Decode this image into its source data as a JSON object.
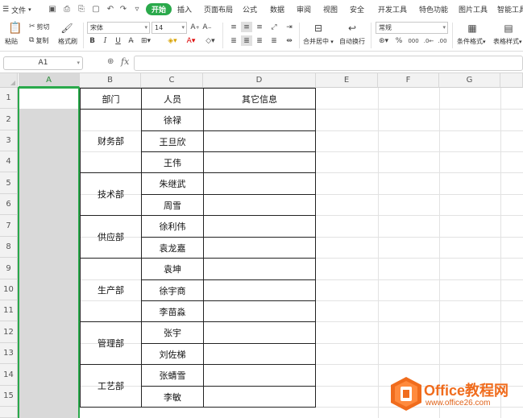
{
  "ribbon": {
    "file_menu": "文件",
    "tabs": [
      "开始",
      "插入",
      "页面布局",
      "公式",
      "数据",
      "审阅",
      "视图",
      "安全",
      "开发工具",
      "特色功能",
      "图片工具",
      "智能工具"
    ],
    "active_tab": "开始",
    "paste": "粘贴",
    "cut": "剪切",
    "copy": "复制",
    "format_painter": "格式刷",
    "font_name": "宋体",
    "font_size": "14",
    "merge_center": "合并居中",
    "wrap_text": "自动换行",
    "number_format": "常规",
    "conditional_format": "条件格式",
    "table_style": "表格样式",
    "accent_color": "#2aa94b"
  },
  "formula_bar": {
    "name_box": "A1",
    "fx_label": "fx",
    "formula_value": ""
  },
  "grid": {
    "columns": [
      "A",
      "B",
      "C",
      "D",
      "E",
      "F",
      "G"
    ],
    "rows": [
      "1",
      "2",
      "3",
      "4",
      "5",
      "6",
      "7",
      "8",
      "9",
      "10",
      "11",
      "12",
      "13",
      "14",
      "15"
    ],
    "selected_column": "A",
    "selection_color": "#2aa94b"
  },
  "table": {
    "headers": {
      "dept": "部门",
      "person": "人员",
      "other": "其它信息"
    },
    "departments": [
      "财务部",
      "技术部",
      "供应部",
      "生产部",
      "管理部",
      "工艺部"
    ],
    "people": [
      "徐禄",
      "王旦欣",
      "王伟",
      "朱继武",
      "周雪",
      "徐利伟",
      "袁龙嘉",
      "袁坤",
      "徐宇商",
      "李苗淼",
      "张宇",
      "刘佐梯",
      "张蜻雪",
      "李敏"
    ]
  },
  "watermark": {
    "title": "Office教程网",
    "url": "www.office26.com"
  }
}
